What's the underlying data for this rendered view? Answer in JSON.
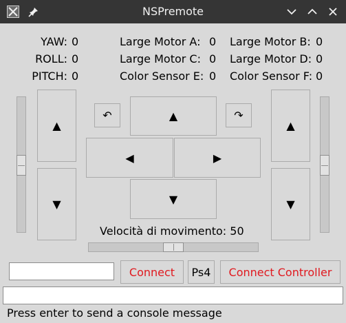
{
  "window": {
    "title": "NSPremote"
  },
  "sensors": {
    "yaw_label": "YAW:",
    "yaw_value": "0",
    "roll_label": "ROLL:",
    "roll_value": "0",
    "pitch_label": "PITCH:",
    "pitch_value": "0"
  },
  "motors": {
    "a_label": "Large Motor A:",
    "a_value": "0",
    "b_label": "Large Motor B:",
    "b_value": "0",
    "c_label": "Large Motor C:",
    "c_value": "0",
    "d_label": "Large Motor D:",
    "d_value": "0",
    "e_label": "Color Sensor E:",
    "e_value": "0",
    "f_label": "Color Sensor F:",
    "f_value": "0"
  },
  "controls": {
    "arrow_up": "▲",
    "arrow_down": "▼",
    "arrow_left": "◀",
    "arrow_right": "▶",
    "rotate_left": "↶",
    "rotate_right": "↷"
  },
  "speed": {
    "label": "Velocità di movimento:",
    "value": "50"
  },
  "connection": {
    "input_value": "",
    "connect_label": "Connect",
    "ps4_label": "Ps4",
    "connect_controller_label": "Connect Controller"
  },
  "console": {
    "input_value": "",
    "hint": "Press enter to send a console message"
  },
  "colors": {
    "titlebar": "#353535",
    "window_bg": "#d9d9d9",
    "accent_red": "#e0191f"
  },
  "icons": [
    "app-icon",
    "pin-icon",
    "minimize-icon",
    "maximize-icon",
    "close-icon"
  ]
}
